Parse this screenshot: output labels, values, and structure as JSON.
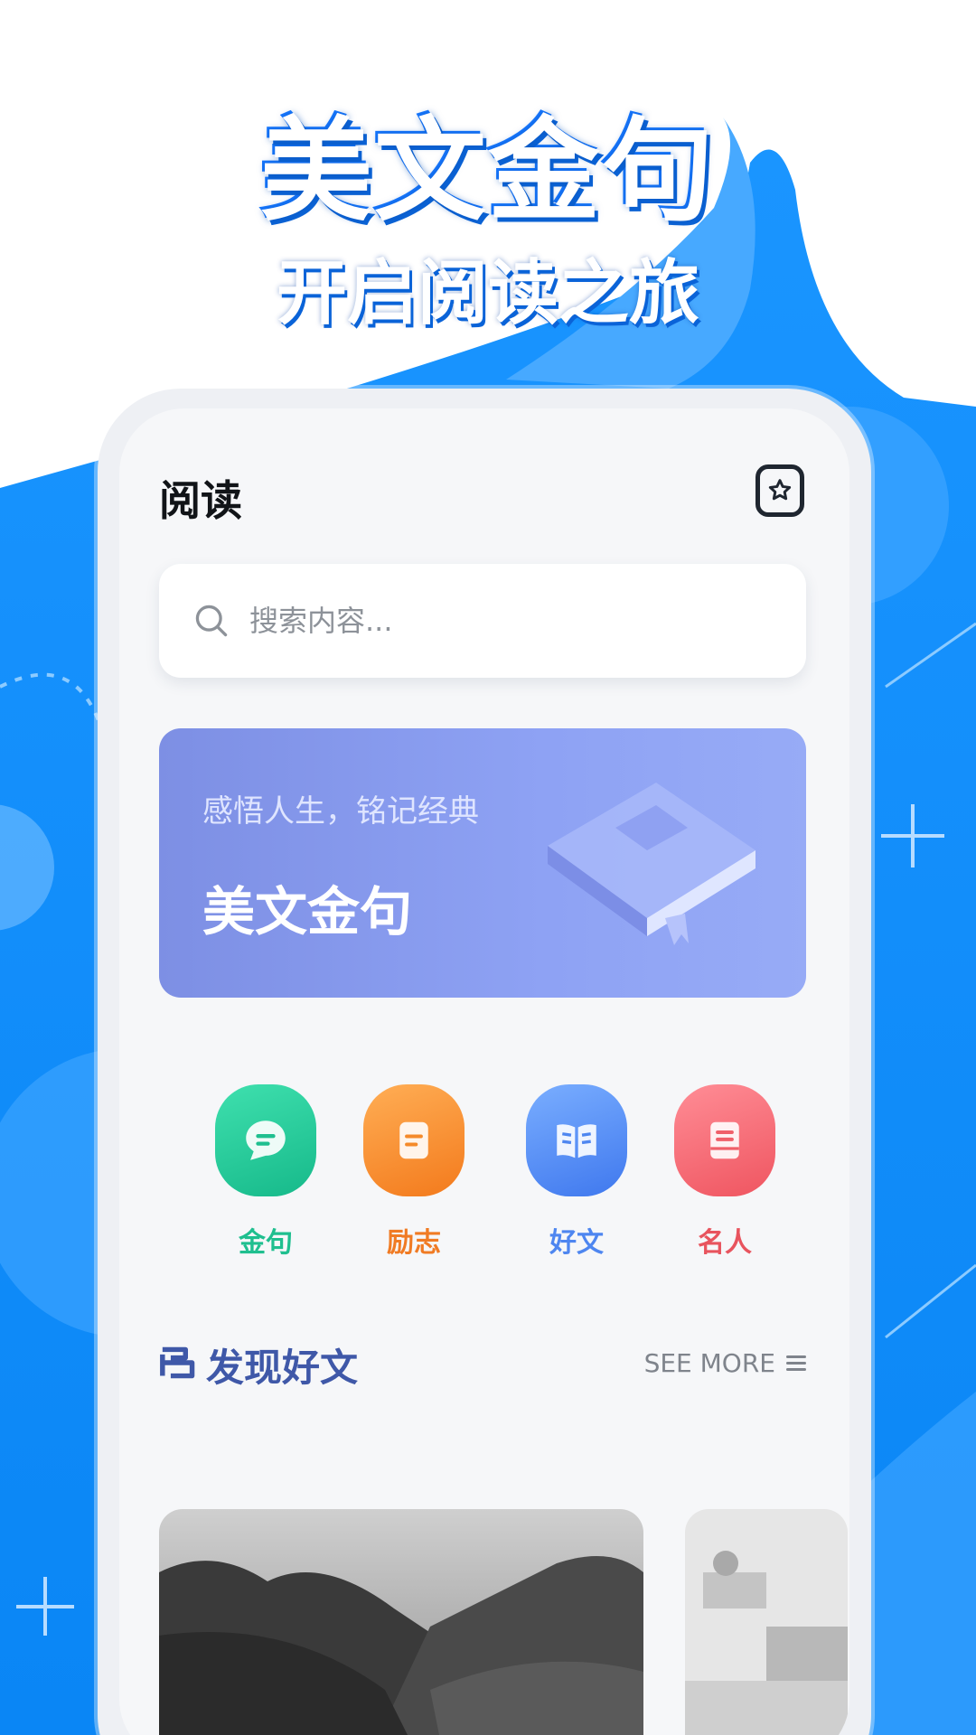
{
  "promo": {
    "title": "美文金句",
    "subtitle": "开启阅读之旅"
  },
  "colors": {
    "background_blue": "#0a8cff",
    "banner_start": "#7d8fe4",
    "banner_end": "#97abf6",
    "section_title": "#3f58a8"
  },
  "app": {
    "title": "阅读",
    "favorites_icon": "star-badge-icon",
    "search": {
      "placeholder": "搜索内容...",
      "value": ""
    },
    "banner": {
      "subtitle": "感悟人生，铭记经典",
      "title": "美文金句"
    },
    "categories": [
      {
        "label": "金句",
        "icon": "chat-bubble-icon",
        "color": "#1fbf8f"
      },
      {
        "label": "励志",
        "icon": "notebook-icon",
        "color": "#f58a2a"
      },
      {
        "label": "好文",
        "icon": "open-book-icon",
        "color": "#4e86f0"
      },
      {
        "label": "名人",
        "icon": "document-icon",
        "color": "#f0606a"
      }
    ],
    "section": {
      "title": "发现好文",
      "see_more": "SEE MORE"
    },
    "articles": [
      {
        "thumbnail": "mountain-valley-photo"
      },
      {
        "thumbnail": "village-sketch-photo"
      }
    ]
  }
}
